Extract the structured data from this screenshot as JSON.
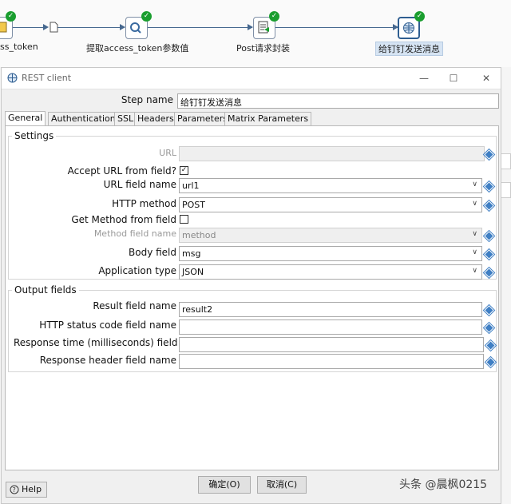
{
  "workflow": {
    "steps": [
      {
        "label": "ss_token"
      },
      {
        "label": "提取access_token参数值"
      },
      {
        "label": "Post请求封装"
      },
      {
        "label": "给钉钉发送消息"
      }
    ]
  },
  "dialog": {
    "title": "REST client",
    "step_name_label": "Step name",
    "step_name_value": "给钉钉发送消息",
    "tabs": [
      {
        "label": "General"
      },
      {
        "label": "Authentication"
      },
      {
        "label": "SSL"
      },
      {
        "label": "Headers"
      },
      {
        "label": "Parameters"
      },
      {
        "label": "Matrix Parameters"
      }
    ],
    "settings": {
      "title": "Settings",
      "url_label": "URL",
      "url_value": "",
      "accept_url_label": "Accept URL from field?",
      "accept_url_checked": true,
      "url_field_label": "URL field name",
      "url_field_value": "url1",
      "http_method_label": "HTTP method",
      "http_method_value": "POST",
      "get_method_label": "Get Method from field",
      "get_method_checked": false,
      "method_field_label": "Method field name",
      "method_field_value": "method",
      "body_field_label": "Body field",
      "body_field_value": "msg",
      "app_type_label": "Application type",
      "app_type_value": "JSON"
    },
    "output": {
      "title": "Output fields",
      "result_label": "Result field name",
      "result_value": "result2",
      "status_label": "HTTP status code field name",
      "status_value": "",
      "response_time_label": "Response time (milliseconds) field",
      "response_time_value": "",
      "response_header_label": "Response header field name",
      "response_header_value": ""
    },
    "buttons": {
      "ok": "确定(O)",
      "cancel": "取消(C)",
      "help": "Help"
    }
  },
  "watermark": "头条 @晨枫0215",
  "colors": {
    "accent": "#3f7fc4",
    "ok_badge": "#1a9e2f",
    "hop": "#46688f"
  }
}
